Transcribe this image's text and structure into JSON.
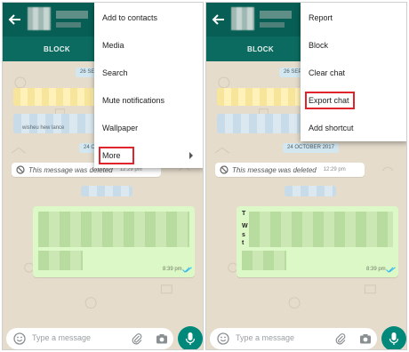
{
  "left": {
    "header": {
      "block_label": "BLOCK"
    },
    "dates": [
      "26 SEP",
      "24 OC"
    ],
    "faint_line": "wisheu hew lance",
    "deleted": {
      "text": "This message was deleted",
      "time": "12:29 pm"
    },
    "green_time": "8:39 pm",
    "input": {
      "placeholder": "Type a message"
    },
    "menu": {
      "items": [
        "Add to contacts",
        "Media",
        "Search",
        "Mute notifications",
        "Wallpaper",
        "More"
      ],
      "highlighted": "More"
    }
  },
  "right": {
    "header": {
      "block_label": "BLOCK"
    },
    "dates": [
      "26 SEP",
      "24 OCTOBER 2017"
    ],
    "deleted": {
      "text": "This message was deleted",
      "time": "12:29 pm"
    },
    "green_time": "8:39 pm",
    "green_letters": [
      "T",
      "W",
      "s",
      "t"
    ],
    "input": {
      "placeholder": "Type a message"
    },
    "menu": {
      "items": [
        "Report",
        "Block",
        "Clear chat",
        "Export chat",
        "Add shortcut"
      ],
      "highlighted": "Export chat"
    }
  },
  "colors": {
    "topbar": "#075e54",
    "subbar": "#0c6b60",
    "wallpaper": "#e5dccc",
    "bubble_out": "#dcf8c6",
    "fab": "#00897b",
    "highlight": "#e0242c",
    "read_ticks": "#34b7f1"
  }
}
